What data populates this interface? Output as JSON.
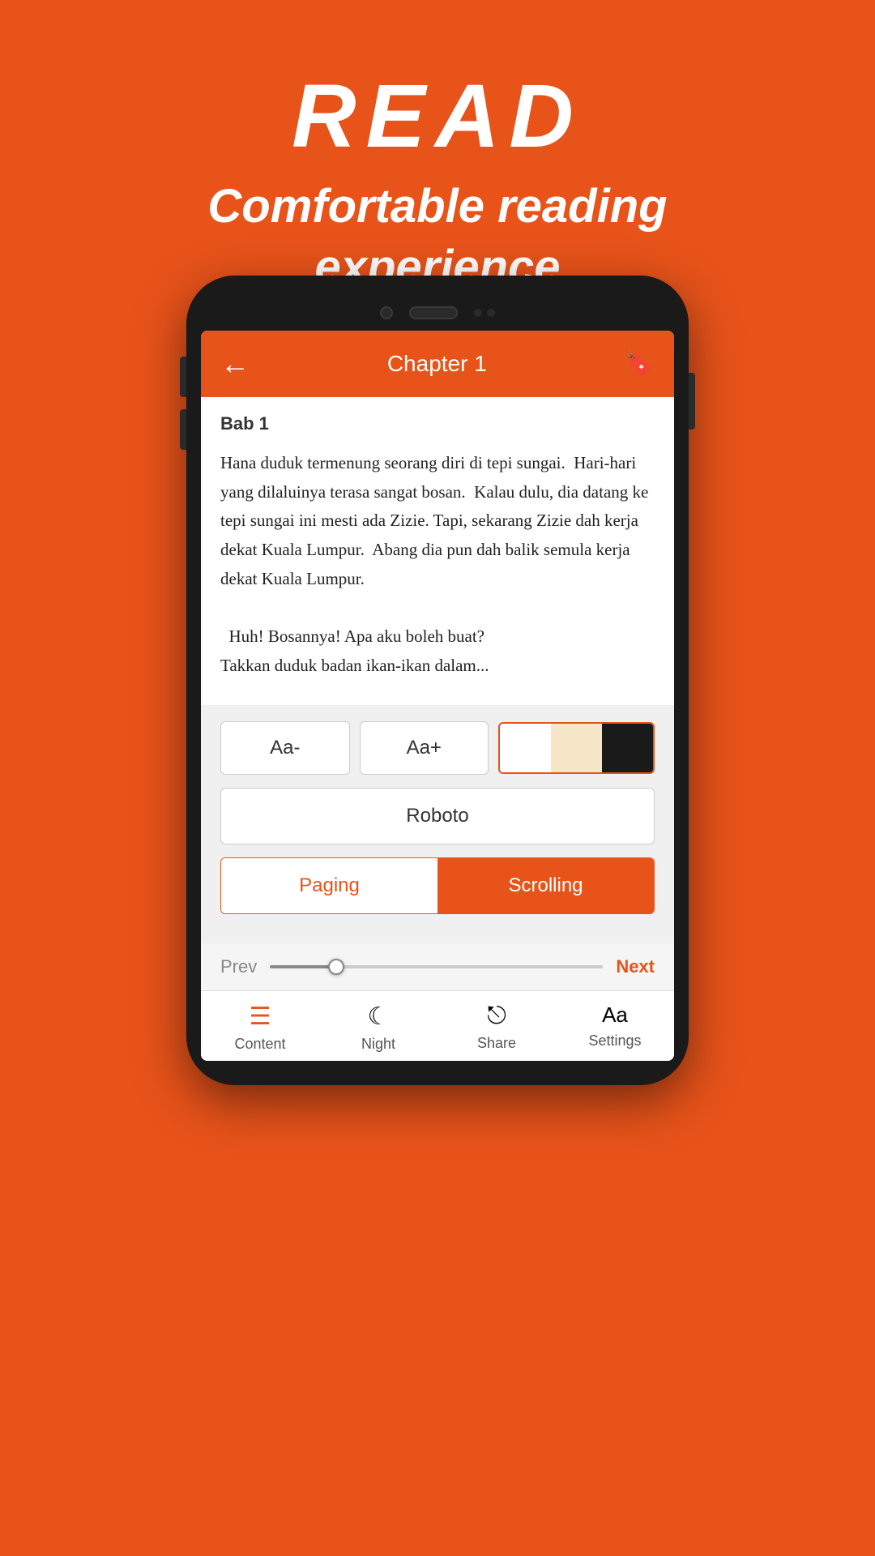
{
  "promo": {
    "title": "READ",
    "subtitle": "Comfortable reading\nexperience"
  },
  "app_bar": {
    "back_icon": "←",
    "title": "Chapter 1",
    "bookmark_icon": "🔖"
  },
  "reading": {
    "chapter_subtitle": "Bab 1",
    "content": "Hana duduk termenung seorang diri di tepi sungai.  Hari-hari yang dilaluinya terasa sangat bosan.  Kalau dulu, dia datang ke tepi sungai ini mesti ada Zizie.  Tapi, sekarang Zizie dah kerja dekat Kuala Lumpur.  Abang dia pun dah balik semula kerja dekat Kuala Lumpur.\n\n  Huh! Bosannya! Apa aku boleh buat?\n Takkan duduk badan ikan-ikan dalam..."
  },
  "settings": {
    "font_decrease": "Aa-",
    "font_increase": "Aa+",
    "font_name": "Roboto",
    "paging_label": "Paging",
    "scrolling_label": "Scrolling"
  },
  "progress": {
    "prev_label": "Prev",
    "next_label": "Next"
  },
  "bottom_nav": {
    "items": [
      {
        "icon": "≡",
        "label": "Content",
        "active": false
      },
      {
        "icon": "☾",
        "label": "Night",
        "active": false
      },
      {
        "icon": "⎋",
        "label": "Share",
        "active": false
      },
      {
        "icon": "Aa",
        "label": "Settings",
        "active": false
      }
    ]
  }
}
